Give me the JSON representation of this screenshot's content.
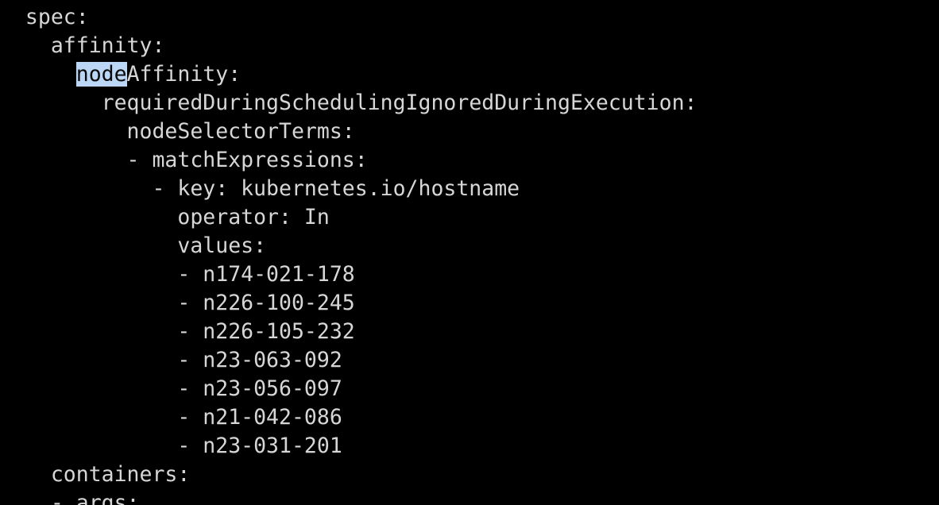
{
  "terminal": {
    "background": "#000000",
    "foreground": "#d6d6d6",
    "selection_background": "#bcd7f5",
    "lines": [
      {
        "indent": "  ",
        "text": "spec:"
      },
      {
        "indent": "    ",
        "text": "affinity:"
      },
      {
        "indent": "      ",
        "selected": "node",
        "text": "Affinity:"
      },
      {
        "indent": "        ",
        "text": "requiredDuringSchedulingIgnoredDuringExecution:"
      },
      {
        "indent": "          ",
        "text": "nodeSelectorTerms:"
      },
      {
        "indent": "          ",
        "text": "- matchExpressions:"
      },
      {
        "indent": "            ",
        "text": "- key: kubernetes.io/hostname"
      },
      {
        "indent": "              ",
        "text": "operator: In"
      },
      {
        "indent": "              ",
        "text": "values:"
      },
      {
        "indent": "              ",
        "text": "- n174-021-178"
      },
      {
        "indent": "              ",
        "text": "- n226-100-245"
      },
      {
        "indent": "              ",
        "text": "- n226-105-232"
      },
      {
        "indent": "              ",
        "text": "- n23-063-092"
      },
      {
        "indent": "              ",
        "text": "- n23-056-097"
      },
      {
        "indent": "              ",
        "text": "- n21-042-086"
      },
      {
        "indent": "              ",
        "text": "- n23-031-201"
      },
      {
        "indent": "    ",
        "text": "containers:"
      },
      {
        "indent": "    ",
        "text": "- args:"
      }
    ]
  }
}
